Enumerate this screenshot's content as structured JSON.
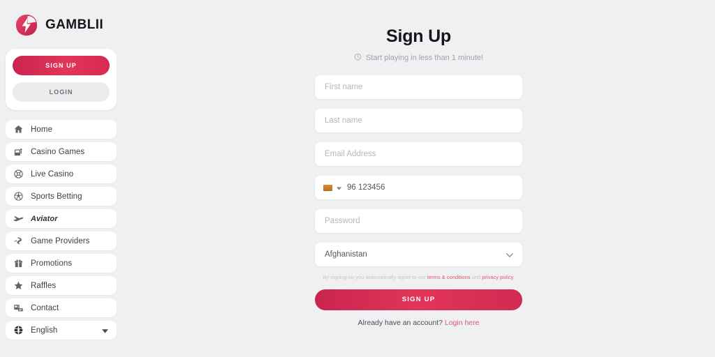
{
  "brand": {
    "name": "GAMBLII",
    "logo_icon": "lightning-bolt-logo",
    "accent": "#d62a53",
    "accent_light": "#e3566f"
  },
  "sidebar": {
    "auth": {
      "signup_label": "SIGN UP",
      "login_label": "LOGIN"
    },
    "items": [
      {
        "label": "Home",
        "icon": "home-icon"
      },
      {
        "label": "Casino Games",
        "icon": "slot-machine-icon"
      },
      {
        "label": "Live Casino",
        "icon": "roulette-icon"
      },
      {
        "label": "Sports Betting",
        "icon": "soccer-ball-icon"
      },
      {
        "label": "Aviator",
        "icon": "airplane-icon"
      },
      {
        "label": "Game Providers",
        "icon": "providers-icon"
      },
      {
        "label": "Promotions",
        "icon": "gift-icon"
      },
      {
        "label": "Raffles",
        "icon": "star-icon"
      },
      {
        "label": "Contact",
        "icon": "contact-icon"
      }
    ],
    "language": {
      "label": "English",
      "icon": "globe-icon",
      "caret": "chevron-down-icon"
    }
  },
  "main": {
    "title": "Sign Up",
    "subtitle": "Start playing in less than 1 minute!",
    "subtitle_icon": "clock-icon",
    "form": {
      "first_name_placeholder": "First name",
      "last_name_placeholder": "Last name",
      "email_placeholder": "Email Address",
      "phone": {
        "flag": "afghanistan-flag-icon",
        "caret": "chevron-down-icon",
        "value": "96 123456"
      },
      "password_placeholder": "Password",
      "country": {
        "selected": "Afghanistan",
        "caret": "chevron-down-icon"
      }
    },
    "terms": {
      "prefix": "By signing up you automatically agree to our ",
      "link1": "terms & conditions",
      "middle": " and ",
      "link2": "privacy policy",
      "suffix": "."
    },
    "submit_label": "SIGN UP",
    "footer": {
      "text": "Already have an account? ",
      "link": "Login here"
    }
  }
}
